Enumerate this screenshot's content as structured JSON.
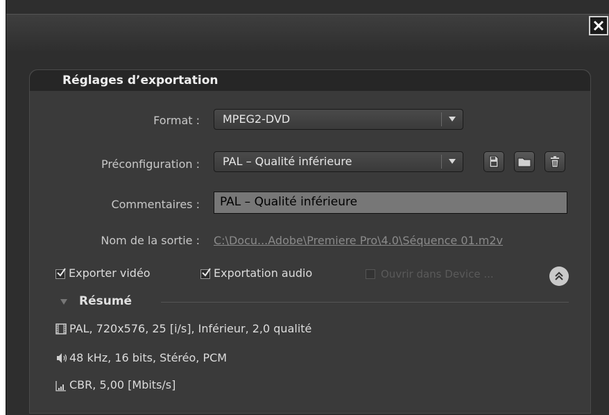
{
  "dialog": {
    "close_icon": "close-x-icon",
    "panel_title": "Réglages d’exportation"
  },
  "format": {
    "label": "Format :",
    "value": "MPEG2-DVD"
  },
  "preset": {
    "label": "Préconfiguration :",
    "value": "PAL – Qualité inférieure",
    "buttons": [
      "save-preset-icon",
      "import-preset-icon",
      "delete-preset-icon"
    ]
  },
  "comments": {
    "label": "Commentaires :",
    "value": "PAL – Qualité inférieure"
  },
  "output": {
    "label": "Nom de la sortie :",
    "value": "C:\\Docu...Adobe\\Premiere Pro\\4.0\\Séquence 01.m2v"
  },
  "options": {
    "export_video": {
      "label": "Exporter vidéo",
      "checked": true
    },
    "export_audio": {
      "label": "Exportation audio",
      "checked": true
    },
    "open_device": {
      "label": "Ouvrir dans Device ...",
      "checked": false,
      "disabled": true
    }
  },
  "summary": {
    "title": "Résumé",
    "video": "PAL, 720x576, 25 [i/s], Inférieur, 2,0 qualité",
    "audio": "48 kHz, 16 bits, Stéréo, PCM",
    "bitrate": "CBR, 5,00 [Mbits/s]"
  }
}
